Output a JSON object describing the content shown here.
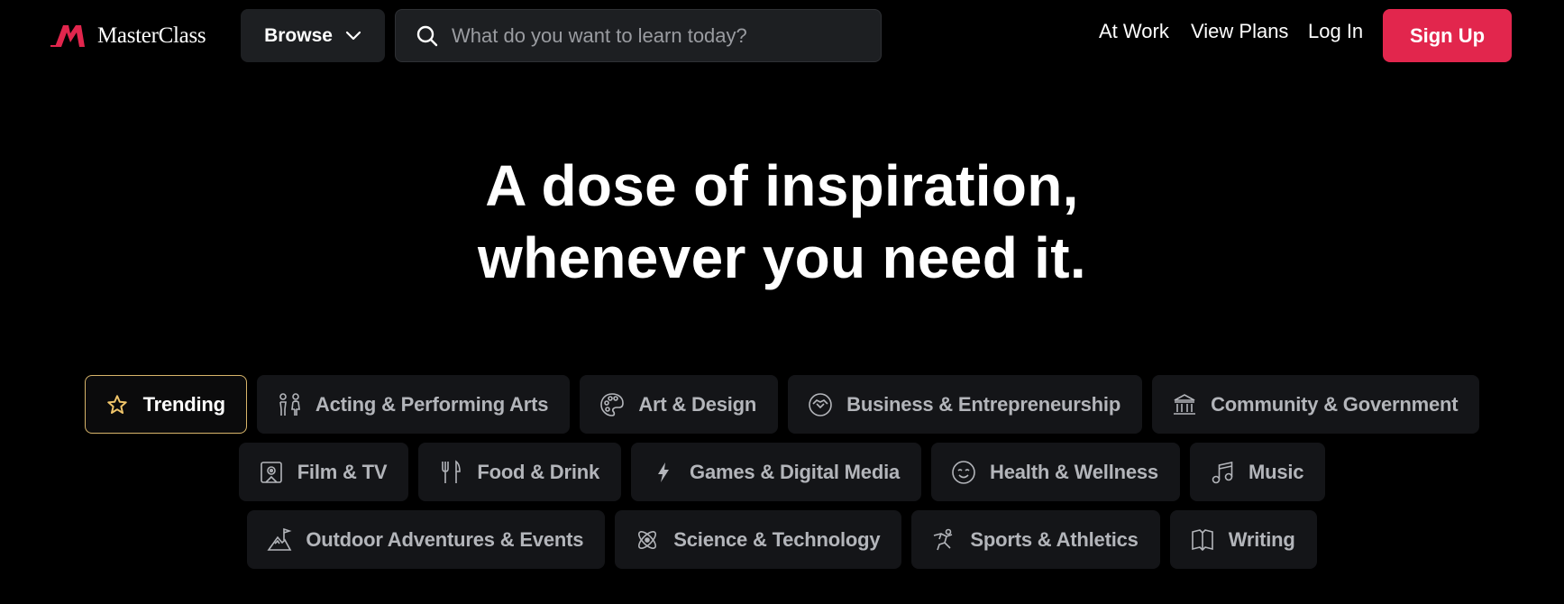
{
  "brand": {
    "name": "MasterClass",
    "accent": "#e2264d"
  },
  "header": {
    "browse_label": "Browse",
    "search_placeholder": "What do you want to learn today?",
    "links": {
      "at_work": "At Work",
      "view_plans": "View Plans",
      "log_in": "Log In"
    },
    "signup_label": "Sign Up"
  },
  "hero": {
    "line1": "A dose of inspiration,",
    "line2": "whenever you need it."
  },
  "categories": {
    "row1": [
      {
        "label": "Trending",
        "icon": "star-icon",
        "active": true
      },
      {
        "label": "Acting & Performing Arts",
        "icon": "performers-icon"
      },
      {
        "label": "Art & Design",
        "icon": "palette-icon"
      },
      {
        "label": "Business & Entrepreneurship",
        "icon": "handshake-icon"
      },
      {
        "label": "Community & Government",
        "icon": "government-building-icon"
      }
    ],
    "row2": [
      {
        "label": "Film & TV",
        "icon": "film-icon"
      },
      {
        "label": "Food & Drink",
        "icon": "fork-knife-icon"
      },
      {
        "label": "Games & Digital Media",
        "icon": "lightning-icon"
      },
      {
        "label": "Health & Wellness",
        "icon": "smile-icon"
      },
      {
        "label": "Music",
        "icon": "music-note-icon"
      }
    ],
    "row3": [
      {
        "label": "Outdoor Adventures & Events",
        "icon": "mountain-flag-icon"
      },
      {
        "label": "Science & Technology",
        "icon": "atom-icon"
      },
      {
        "label": "Sports & Athletics",
        "icon": "athlete-icon"
      },
      {
        "label": "Writing",
        "icon": "book-icon"
      }
    ]
  }
}
